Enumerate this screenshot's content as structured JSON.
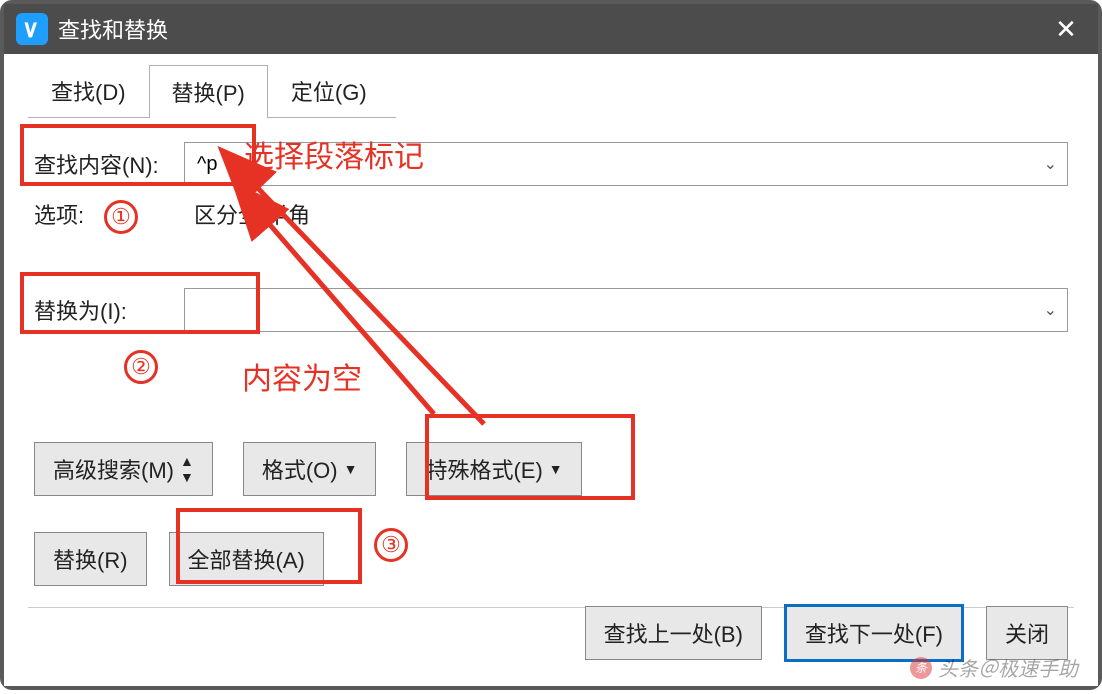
{
  "window": {
    "title": "查找和替换"
  },
  "tabs": {
    "find": "查找(D)",
    "replace": "替换(P)",
    "goto": "定位(G)"
  },
  "find": {
    "label": "查找内容(N):",
    "value": "^p"
  },
  "options": {
    "label": "选项:",
    "value": "区分全/半角"
  },
  "replace": {
    "label": "替换为(I):",
    "value": ""
  },
  "buttons": {
    "advanced": "高级搜索(M)",
    "format": "格式(O)",
    "special": "特殊格式(E)",
    "replace_one": "替换(R)",
    "replace_all": "全部替换(A)",
    "find_prev": "查找上一处(B)",
    "find_next": "查找下一处(F)",
    "close": "关闭"
  },
  "annotations": {
    "tip1": "选择段落标记",
    "tip2": "内容为空",
    "n1": "①",
    "n2": "②",
    "n3": "③"
  },
  "watermark": "头条＠极速手助"
}
